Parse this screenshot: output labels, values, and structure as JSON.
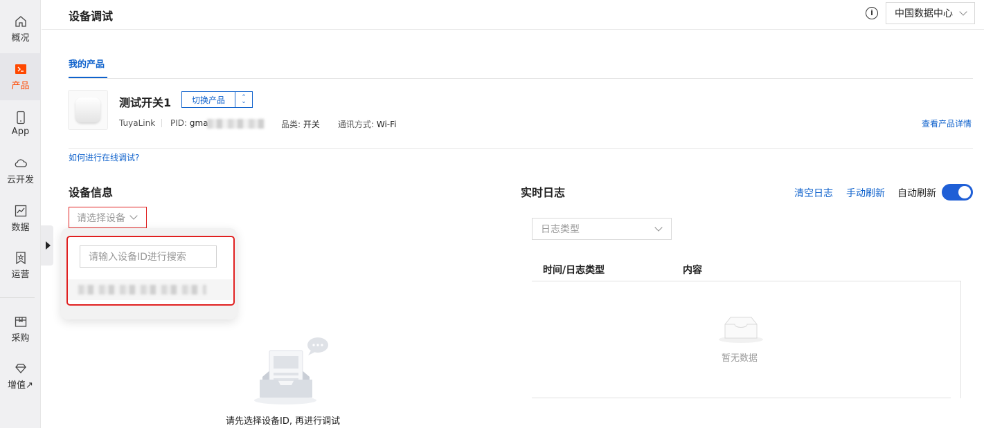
{
  "sidebar": {
    "items": [
      {
        "label": "概况",
        "icon": "home-icon"
      },
      {
        "label": "产品",
        "icon": "terminal-icon",
        "active": true
      },
      {
        "label": "App",
        "icon": "phone-icon"
      },
      {
        "label": "云开发",
        "icon": "cloud-icon"
      },
      {
        "label": "数据",
        "icon": "chart-icon"
      },
      {
        "label": "运营",
        "icon": "bookmark-star-icon"
      },
      {
        "label": "采购",
        "icon": "box-icon"
      },
      {
        "label": "增值↗",
        "icon": "diamond-icon"
      }
    ]
  },
  "header": {
    "title": "设备调试",
    "info_icon": "i",
    "region": "中国数据中心"
  },
  "tabs": {
    "active": "我的产品"
  },
  "product": {
    "name": "测试开关1",
    "switch_label": "切换产品",
    "protocol": "TuyaLink",
    "pid_label": "PID:",
    "pid_value": "gma",
    "category_label": "品类:",
    "category_value": "开关",
    "comm_label": "通讯方式:",
    "comm_value": "Wi-Fi",
    "view_detail": "查看产品详情"
  },
  "help_link": "如何进行在线调试?",
  "device_info": {
    "title": "设备信息",
    "select_placeholder": "请选择设备",
    "search_placeholder": "请输入设备ID进行搜索",
    "empty_message": "请先选择设备ID, 再进行调试"
  },
  "realtime_log": {
    "title": "实时日志",
    "clear": "清空日志",
    "manual_refresh": "手动刷新",
    "auto_refresh": "自动刷新",
    "auto_refresh_on": true,
    "log_type_placeholder": "日志类型",
    "columns": [
      "时间/日志类型",
      "内容"
    ],
    "empty_text": "暂无数据"
  },
  "colors": {
    "accent": "#0f62cc",
    "active_nav": "#ff4800",
    "highlight": "#e02020",
    "toggle": "#1f5fd6"
  }
}
